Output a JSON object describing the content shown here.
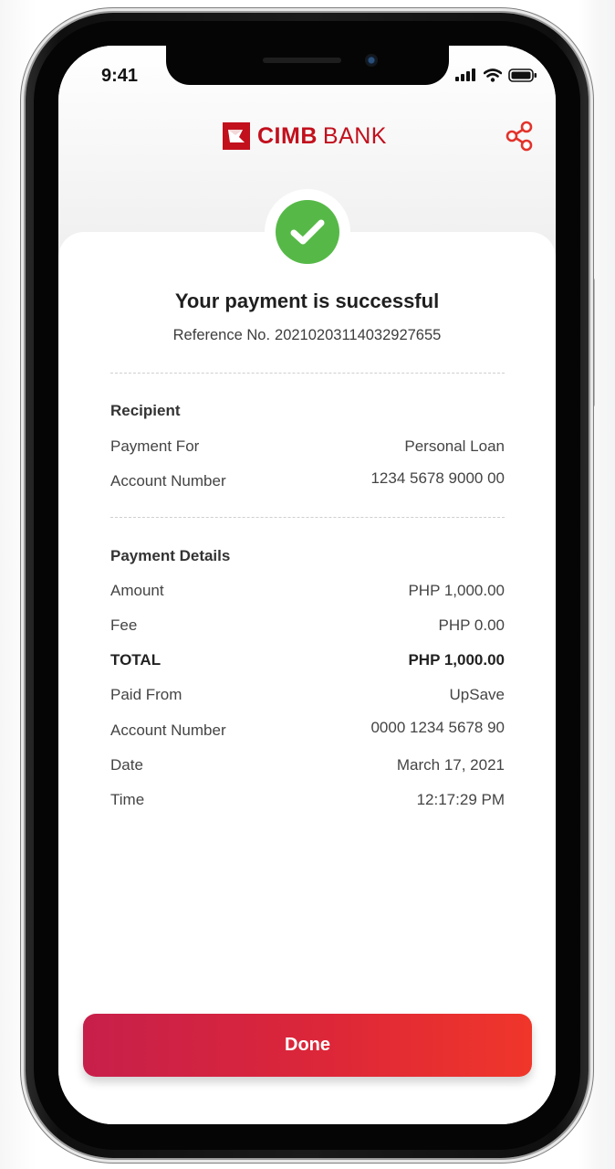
{
  "status_bar": {
    "time": "9:41"
  },
  "header": {
    "brand_bold": "CIMB",
    "brand_light": "BANK",
    "share_icon": "share-icon"
  },
  "receipt": {
    "title": "Your payment is successful",
    "reference_label": "Reference No.",
    "reference_number": "20210203114032927655",
    "recipient": {
      "heading": "Recipient",
      "payment_for_label": "Payment For",
      "payment_for_value": "Personal Loan",
      "account_label": "Account Number",
      "account_value": "1234 5678 9000 00"
    },
    "details": {
      "heading": "Payment Details",
      "amount_label": "Amount",
      "amount_value": "PHP 1,000.00",
      "fee_label": "Fee",
      "fee_value": "PHP 0.00",
      "total_label": "TOTAL",
      "total_value": "PHP 1,000.00",
      "paid_from_label": "Paid From",
      "paid_from_value": "UpSave",
      "account_label": "Account Number",
      "account_value": "0000 1234 5678 90",
      "date_label": "Date",
      "date_value": "March 17, 2021",
      "time_label": "Time",
      "time_value": "12:17:29 PM"
    }
  },
  "actions": {
    "done_label": "Done"
  },
  "colors": {
    "brand_red": "#c2101d",
    "success_green": "#56b947",
    "button_gradient_start": "#c71f4b",
    "button_gradient_end": "#f0362a"
  }
}
